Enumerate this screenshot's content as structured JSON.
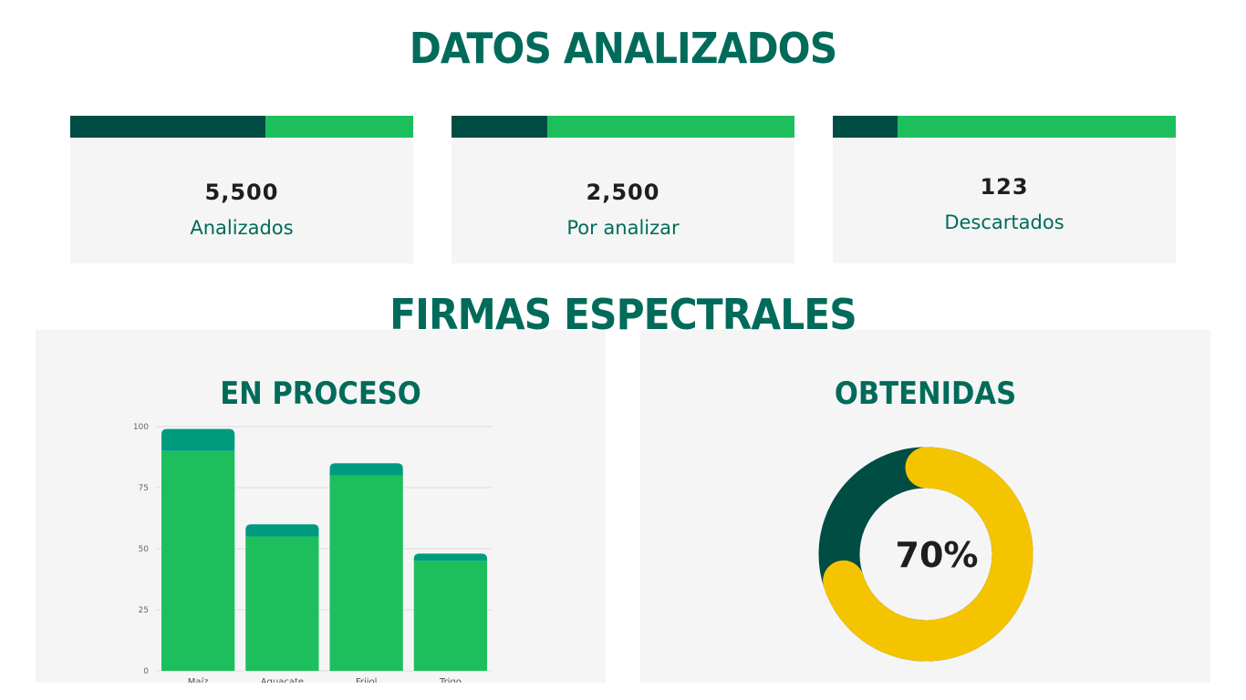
{
  "header": {
    "title": "DATOS ANALIZADOS"
  },
  "stats": [
    {
      "value": "5,500",
      "label": "Analizados",
      "progress": 0.57
    },
    {
      "value": "2,500",
      "label": "Por analizar",
      "progress": 0.28
    },
    {
      "value": "123",
      "label": "Descartados",
      "progress": 0.19
    }
  ],
  "section": {
    "title": "FIRMAS ESPECTRALES"
  },
  "panels": {
    "left_title": "EN PROCESO",
    "right_title": "OBTENIDAS"
  },
  "colors": {
    "dark_green": "#004d43",
    "bright_green": "#1dbf5d",
    "teal": "#009b7f",
    "yellow": "#f5c400",
    "title_green": "#006b5a"
  },
  "chart_data": [
    {
      "type": "bar",
      "stacked": true,
      "categories": [
        "Maíz",
        "Aguacate",
        "Frijol",
        "Trigo"
      ],
      "series": [
        {
          "values": [
            90,
            55,
            80,
            45
          ],
          "color": "#1dbf5d"
        },
        {
          "values": [
            9,
            5,
            5,
            3
          ],
          "color": "#009b7f"
        }
      ],
      "ylim": [
        0,
        100
      ],
      "yticks": [
        0,
        25,
        50,
        75,
        100
      ],
      "grid": true,
      "title": "EN PROCESO"
    },
    {
      "type": "pie",
      "donut": true,
      "center_label": "70%",
      "values": [
        70,
        30
      ],
      "colors": [
        "#f5c400",
        "#004d43"
      ],
      "title": "OBTENIDAS"
    }
  ]
}
